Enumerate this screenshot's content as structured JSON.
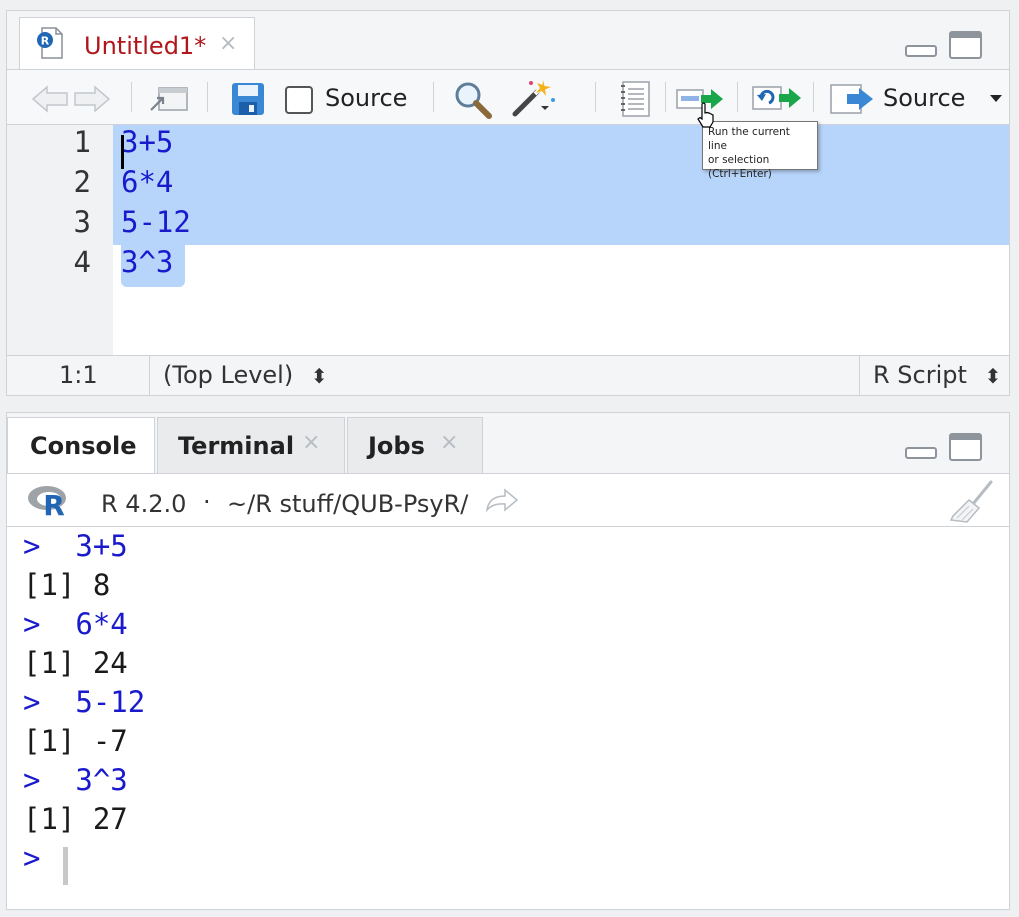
{
  "editor": {
    "tab": {
      "title": "Untitled1*",
      "close": "×"
    },
    "toolbar": {
      "source_on_save_label": "Source",
      "source_button_label": "Source"
    },
    "code_lines": [
      {
        "number": "1",
        "text": "3+5"
      },
      {
        "number": "2",
        "text": "6*4"
      },
      {
        "number": "3",
        "text": "5-12"
      },
      {
        "number": "4",
        "text": "3^3"
      }
    ],
    "tooltip": {
      "line1": "Run the current line",
      "line2": "or selection",
      "line3": "(Ctrl+Enter)"
    },
    "status": {
      "position": "1:1",
      "scope": "(Top Level)",
      "file_type": "R Script",
      "updown": "⬍"
    }
  },
  "console": {
    "tabs": [
      {
        "label": "Console",
        "close": ""
      },
      {
        "label": "Terminal",
        "close": "×"
      },
      {
        "label": "Jobs",
        "close": "×"
      }
    ],
    "header": {
      "r_version": "R 4.2.0",
      "dot": "·",
      "path": "~/R stuff/QUB-PsyR/"
    },
    "lines": [
      {
        "kind": "in",
        "text": ">  3+5"
      },
      {
        "kind": "out",
        "text": "[1] 8"
      },
      {
        "kind": "in",
        "text": ">  6*4"
      },
      {
        "kind": "out",
        "text": "[1] 24"
      },
      {
        "kind": "in",
        "text": ">  5-12"
      },
      {
        "kind": "out",
        "text": "[1] -7"
      },
      {
        "kind": "in",
        "text": ">  3^3"
      },
      {
        "kind": "out",
        "text": "[1] 27"
      },
      {
        "kind": "in",
        "text": ">"
      }
    ]
  },
  "colors": {
    "tab_title": "#b0161c",
    "code_text": "#1a1acd",
    "selection": "#b7d5fb",
    "run_arrow": "#1aa64a",
    "r_logo_blue": "#2166b5"
  },
  "icons": [
    "r-document-icon",
    "back-arrow-icon",
    "forward-arrow-icon",
    "show-in-window-icon",
    "save-icon",
    "search-icon",
    "magic-wand-icon",
    "notebook-icon",
    "run-line-icon",
    "rerun-icon",
    "source-icon",
    "r-logo-icon",
    "go-to-directory-icon",
    "broom-icon"
  ]
}
